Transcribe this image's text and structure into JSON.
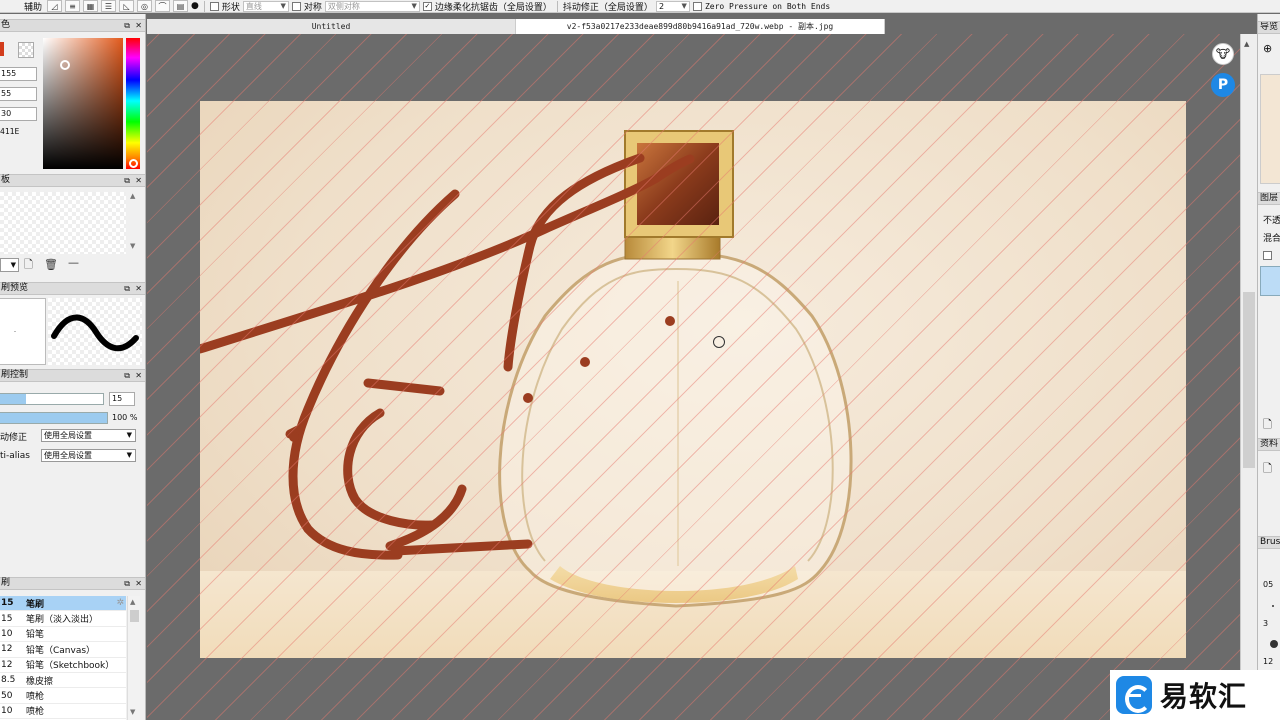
{
  "toolbar": {
    "assist_label": "辅助",
    "shape_label": "形状",
    "shape_value": "直线",
    "symmetry_label": "对称",
    "symmetry_value": "双侧对称",
    "edge_aa_label": "边缘柔化抗锯齿（全局设置）",
    "stabilizer_label": "抖动修正（全局设置）",
    "stabilizer_value": "2",
    "zero_pressure_label": "Zero Pressure on Both Ends"
  },
  "tabs": [
    {
      "label": "Untitled"
    },
    {
      "label": "v2-f53a0217e233deae899d80b9416a91ad_720w.webp - 副本.jpg"
    }
  ],
  "left_panel": {
    "color_title": "色",
    "rgb_values": [
      "155",
      "55",
      "30"
    ],
    "hex_value": "411E",
    "swatch_title": "板",
    "preview_title": "刷预览",
    "control_title": "刷控制",
    "size_value": "15",
    "opacity_value": "100 %",
    "stabilizer_row_label": "动修正",
    "stabilizer_row_value": "使用全局设置",
    "antialias_row_label": "ti-alias",
    "antialias_row_value": "使用全局设置",
    "brush_title": "刷",
    "brushes": [
      {
        "size": "15",
        "name": "笔刷"
      },
      {
        "size": "15",
        "name": "笔刷（淡入淡出）"
      },
      {
        "size": "10",
        "name": "铅笔"
      },
      {
        "size": "12",
        "name": "铅笔（Canvas）"
      },
      {
        "size": "12",
        "name": "铅笔（Sketchbook）"
      },
      {
        "size": "8.5",
        "name": "橡皮擦"
      },
      {
        "size": "50",
        "name": "喷枪"
      },
      {
        "size": "10",
        "name": "喷枪"
      }
    ]
  },
  "right_panel": {
    "navigator_title": "导览",
    "layer_title": "图层",
    "opacity_label": "不透",
    "blend_label": "混合",
    "material_title": "资料",
    "brush_title": "Brus",
    "size_labels": [
      "05",
      "3",
      "12"
    ]
  },
  "watermark": {
    "text": "易软汇"
  },
  "colors": {
    "stroke": "#9b3d20",
    "selected_row": "#a8d2f5",
    "hatch": "#e6786e"
  }
}
